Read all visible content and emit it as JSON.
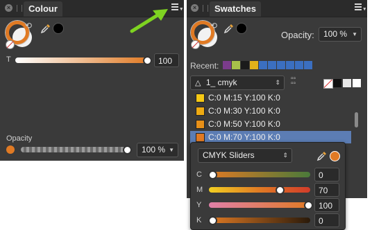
{
  "colour_panel": {
    "tab_title": "Colour",
    "t_label": "T",
    "t_value": "100",
    "opacity_label": "Opacity",
    "opacity_value": "100 %",
    "primary_color": "#e07a24"
  },
  "swatches_panel": {
    "tab_title": "Swatches",
    "opacity_label": "Opacity:",
    "opacity_value": "100 %",
    "recent_label": "Recent:",
    "recent_colors": [
      "#7b3c8c",
      "#a8c04a",
      "#1b1b1b",
      "#e2b21a",
      "#3b6fc0",
      "#3b6fc0",
      "#3b6fc0",
      "#3b6fc0",
      "#3b6fc0",
      "#3b6fc0"
    ],
    "palette_name": "1_ cmyk",
    "swatches": [
      {
        "label": "C:0 M:15 Y:100 K:0",
        "color": "#f5c814"
      },
      {
        "label": "C:0 M:30 Y:100 K:0",
        "color": "#eeaa12"
      },
      {
        "label": "C:0 M:50 Y:100 K:0",
        "color": "#e89018"
      },
      {
        "label": "C:0 M:70 Y:100 K:0",
        "color": "#e07a24"
      }
    ],
    "selected_swatch_index": 3
  },
  "cmyk_popup": {
    "mode": "CMYK Sliders",
    "sliders": [
      {
        "label": "C",
        "value": "0",
        "level": 0
      },
      {
        "label": "M",
        "value": "70",
        "level": 0.7
      },
      {
        "label": "Y",
        "value": "100",
        "level": 1.0
      },
      {
        "label": "K",
        "value": "0",
        "level": 0
      }
    ]
  }
}
